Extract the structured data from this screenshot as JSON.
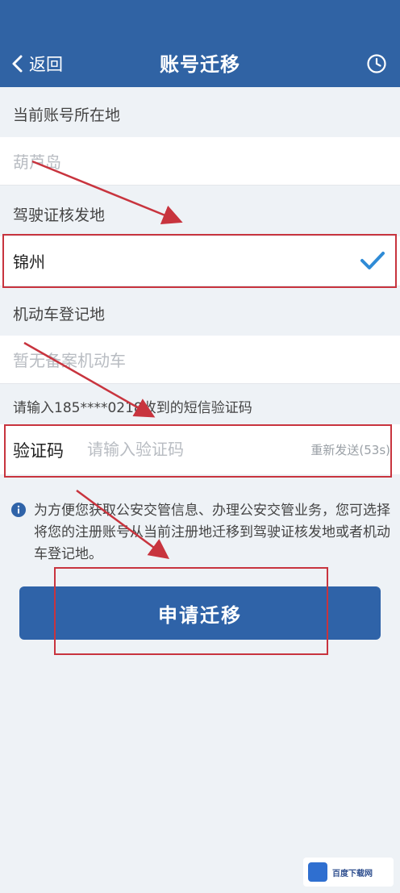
{
  "header": {
    "back_label": "返回",
    "title": "账号迁移",
    "history_icon": "clock-icon"
  },
  "current_location": {
    "label": "当前账号所在地",
    "value": "葫芦岛"
  },
  "license_location": {
    "label": "驾驶证核发地",
    "value": "锦州",
    "selected": true
  },
  "vehicle_location": {
    "label": "机动车登记地",
    "value": "暂无备案机动车"
  },
  "sms": {
    "prompt": "请输入185****0218收到的短信验证码",
    "field_label": "验证码",
    "placeholder": "请输入验证码",
    "resend_label": "重新发送(53s)"
  },
  "info": {
    "text": "为方便您获取公安交管信息、办理公安交管业务，您可选择将您的注册账号从当前注册地迁移到驾驶证核发地或者机动车登记地。"
  },
  "apply_button": "申请迁移",
  "watermark": {
    "text": "百度下载网"
  },
  "colors": {
    "header_bg": "#3063a4",
    "button_bg": "#2f63a8",
    "check": "#2f8bd6",
    "annotation_red": "#c8343e"
  }
}
